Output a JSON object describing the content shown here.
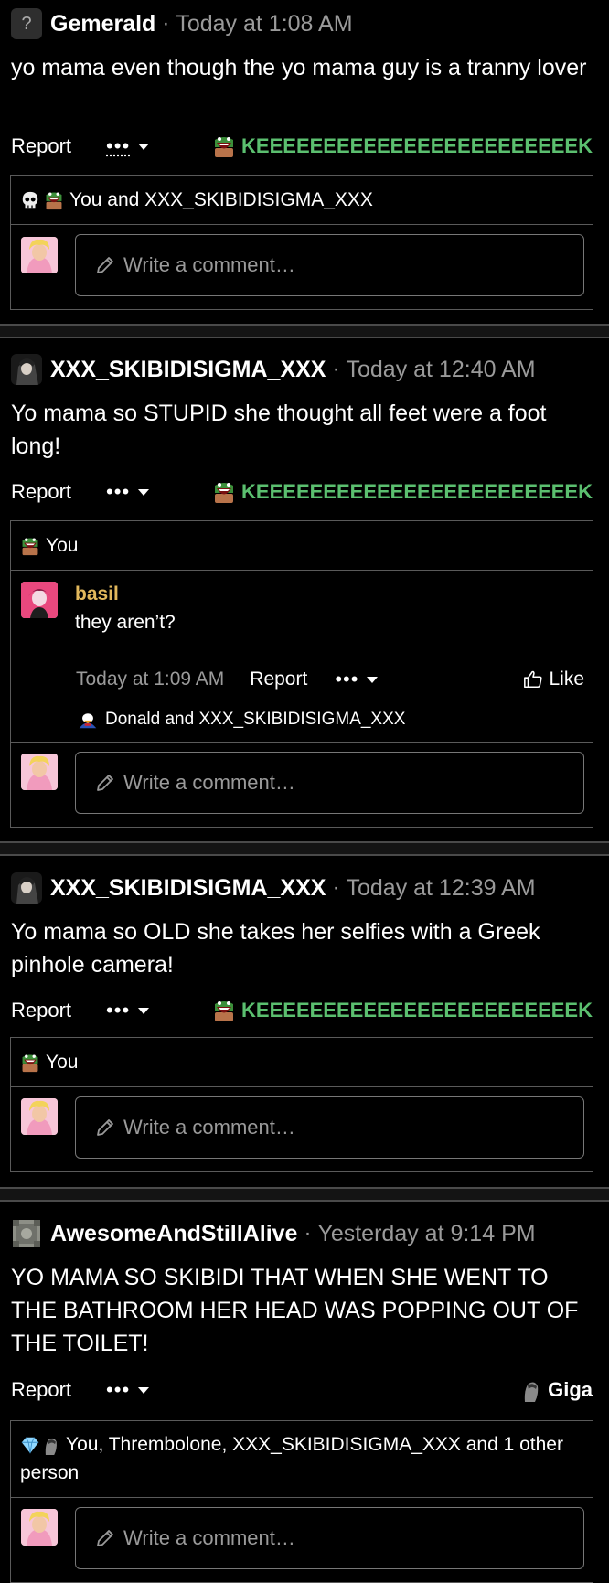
{
  "posts": [
    {
      "author": "Gemerald",
      "avatar": "question-mark-avatar",
      "avatar_glyph": "?",
      "time": "Today at 1:08 AM",
      "text": "yo mama even though the yo mama guy is a tranny lover",
      "report": "Report",
      "more": "•••",
      "reaction": {
        "icon": "laughing-plant-icon",
        "label": "KEEEEEEEEEEEEEEEEEEEEEEEEK",
        "color": "#5bbf6f"
      },
      "reactors": "You and XXX_SKIBIDISIGMA_XXX",
      "reactor_icons": [
        "skull-icon",
        "laughing-plant-icon"
      ],
      "comment_placeholder": "Write a comment…"
    },
    {
      "author": "XXX_SKIBIDISIGMA_XXX",
      "avatar": "anime-character-avatar",
      "time": "Today at 12:40 AM",
      "text": "Yo mama so STUPID she thought all feet were a foot long!",
      "report": "Report",
      "more": "•••",
      "reaction": {
        "icon": "laughing-plant-icon",
        "label": "KEEEEEEEEEEEEEEEEEEEEEEEEK",
        "color": "#5bbf6f"
      },
      "reactors": "You",
      "reactor_icons": [
        "laughing-plant-icon"
      ],
      "reply": {
        "author": "basil",
        "author_color": "#e2b85c",
        "text": "they aren’t?",
        "time": "Today at 1:09 AM",
        "report": "Report",
        "more": "•••",
        "like": "Like",
        "reactors": "Donald and XXX_SKIBIDISIGMA_XXX"
      },
      "comment_placeholder": "Write a comment…"
    },
    {
      "author": "XXX_SKIBIDISIGMA_XXX",
      "avatar": "anime-character-avatar",
      "time": "Today at 12:39 AM",
      "text": "Yo mama so OLD she takes her selfies with a Greek pinhole camera!",
      "report": "Report",
      "more": "•••",
      "reaction": {
        "icon": "laughing-plant-icon",
        "label": "KEEEEEEEEEEEEEEEEEEEEEEEEK",
        "color": "#5bbf6f"
      },
      "reactors": "You",
      "reactor_icons": [
        "laughing-plant-icon"
      ],
      "comment_placeholder": "Write a comment…"
    },
    {
      "author": "AwesomeAndStillAlive",
      "avatar": "companion-cube-avatar",
      "time": "Yesterday at 9:14 PM",
      "text": "YO MAMA SO SKIBIDI THAT WHEN SHE WENT TO THE BATHROOM HER HEAD WAS POPPING OUT OF THE TOILET!",
      "report": "Report",
      "more": "•••",
      "reaction": {
        "icon": "giga-chad-icon",
        "label": "Giga",
        "color": "#ffffff"
      },
      "reactors": "You, Thrembolone, XXX_SKIBIDISIGMA_XXX and 1 other person",
      "reactor_icons": [
        "diamond-icon",
        "giga-chad-icon"
      ],
      "comment_placeholder": "Write a comment…"
    }
  ]
}
